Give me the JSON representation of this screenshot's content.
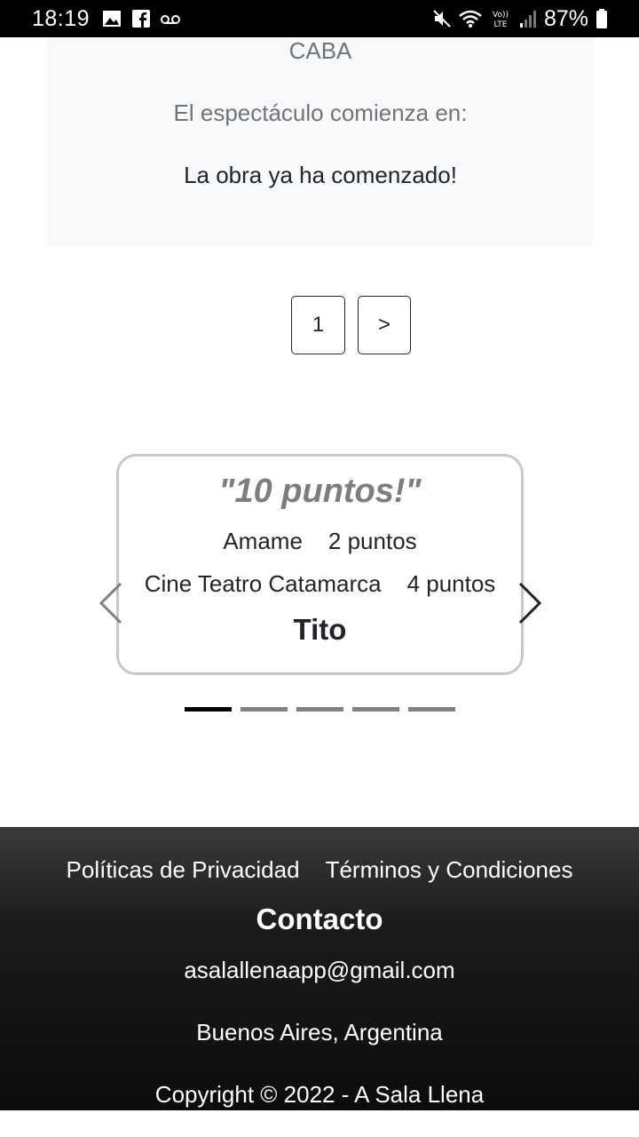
{
  "status_bar": {
    "time": "18:19",
    "battery": "87%",
    "icons": [
      "gallery-icon",
      "facebook-icon",
      "voicemail-icon",
      "mute-icon",
      "wifi-icon",
      "volte-icon",
      "signal-icon",
      "battery-icon"
    ]
  },
  "show_card": {
    "city": "CABA",
    "starts_label": "El espectáculo comienza en:",
    "status": "La obra ya ha comenzado!"
  },
  "pagination": {
    "current_page": "1",
    "next_label": ">"
  },
  "review": {
    "quote": "\"10 puntos!\"",
    "play_name": "Amame",
    "play_score": "2 puntos",
    "venue_name": "Cine Teatro Catamarca",
    "venue_score": "4 puntos",
    "author": "Tito",
    "slide_count": 5,
    "active_slide": 1
  },
  "footer": {
    "privacy_link": "Políticas de Privacidad",
    "terms_link": "Términos y Condiciones",
    "contact_title": "Contacto",
    "email": "asalallenaapp@gmail.com",
    "location": "Buenos Aires, Argentina",
    "copyright": "Copyright © 2022 - A Sala Llena"
  },
  "colors": {
    "card_bg": "#f8f9fa",
    "muted_text": "#6c757d",
    "footer_bg": "#1b1b1b",
    "indicator_active": "#000000",
    "indicator_inactive": "#808080"
  }
}
